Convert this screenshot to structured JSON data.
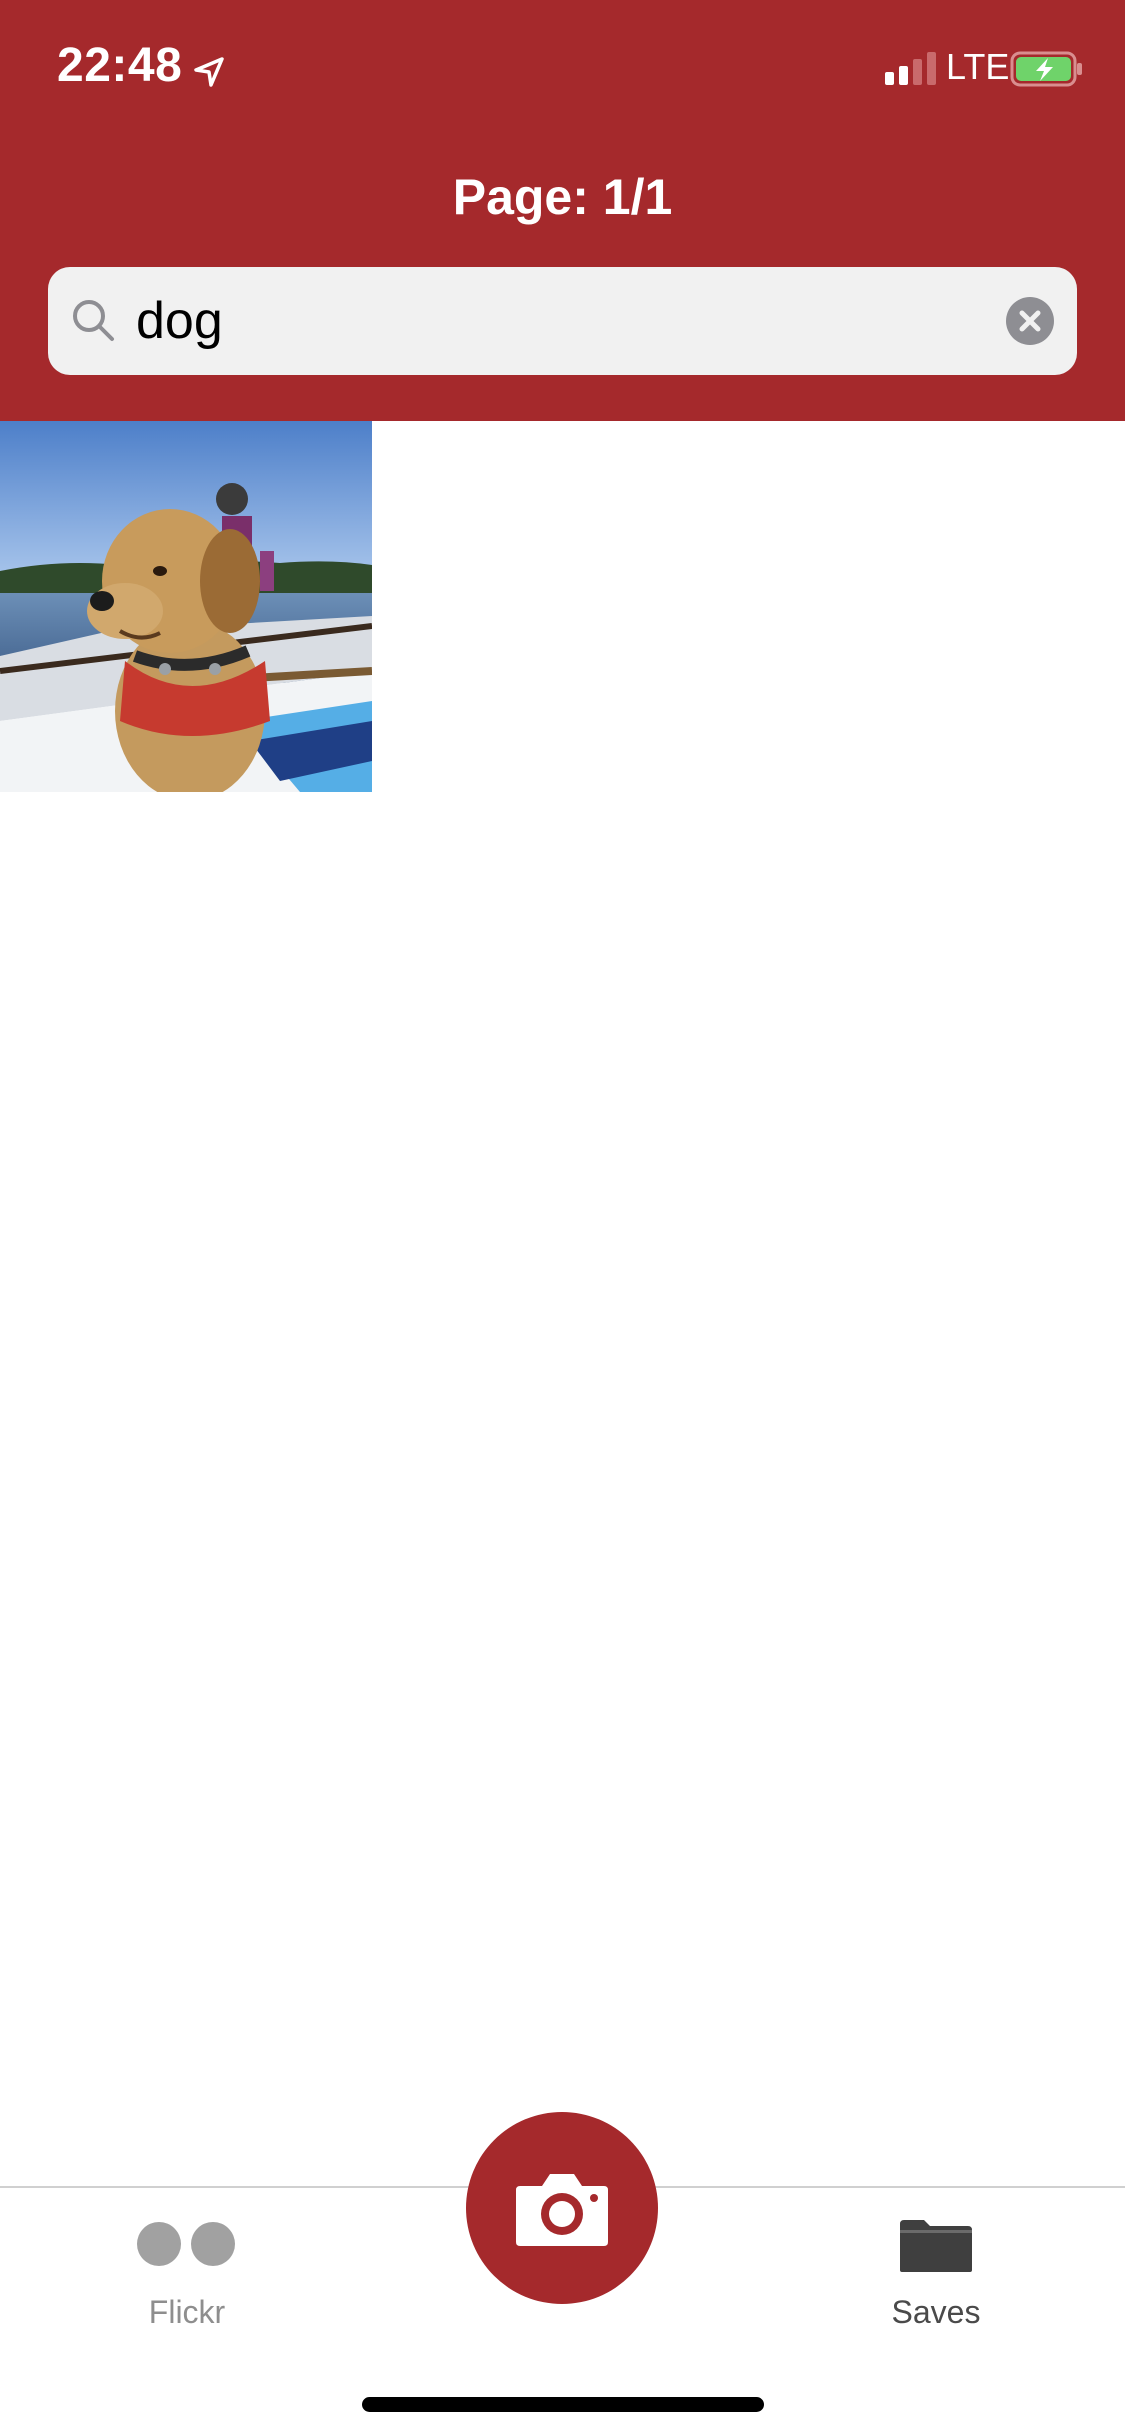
{
  "status_bar": {
    "time": "22:48",
    "network": "LTE",
    "location_icon": "location-arrow-icon",
    "signal_icon": "cellular-signal-icon",
    "battery_icon": "battery-charging-icon"
  },
  "header": {
    "title": "Page: 1/1",
    "background_color": "#a5292c"
  },
  "search": {
    "value": "dog",
    "search_icon": "magnifier-icon",
    "clear_icon": "clear-x-icon"
  },
  "results": {
    "items": [
      {
        "subject": "dog-photo-thumbnail"
      }
    ]
  },
  "tab_bar": {
    "flickr_label": "Flickr",
    "flickr_icon": "flickr-dots-icon",
    "camera_icon": "camera-icon",
    "saves_label": "Saves",
    "saves_icon": "folder-icon"
  }
}
